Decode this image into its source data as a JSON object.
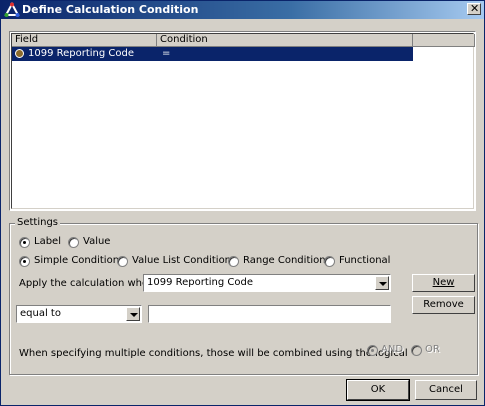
{
  "window": {
    "title": "Define Calculation Condition"
  },
  "grid": {
    "columns": [
      "Field",
      "Condition"
    ],
    "rows": [
      {
        "field": "1099 Reporting Code",
        "condition": "="
      }
    ]
  },
  "settings": {
    "group_label": "Settings",
    "type_label": "Label",
    "type_value": "Value",
    "cond_simple": "Simple Condition",
    "cond_valuelist": "Value List Condition",
    "cond_range": "Range Condition",
    "cond_functional": "Functional",
    "apply_label": "Apply the calculation when",
    "apply_field": "1099 Reporting Code",
    "operator": "equal to",
    "value_text": "",
    "new_label": "New",
    "remove_label": "Remove",
    "logical_text": "When specifying multiple conditions, those will be combined using the logical",
    "and_label": "AND",
    "or_label": "OR"
  },
  "footer": {
    "ok_label": "OK",
    "cancel_label": "Cancel"
  }
}
